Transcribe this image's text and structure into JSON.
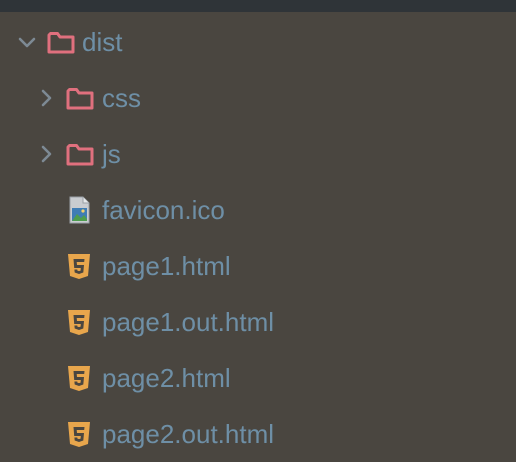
{
  "tree": {
    "root": {
      "label": "dist",
      "expanded": true,
      "icon": "folder-icon"
    },
    "children": [
      {
        "label": "css",
        "type": "folder",
        "expanded": false,
        "icon": "folder-icon"
      },
      {
        "label": "js",
        "type": "folder",
        "expanded": false,
        "icon": "folder-icon"
      },
      {
        "label": "favicon.ico",
        "type": "file",
        "icon": "image-file-icon"
      },
      {
        "label": "page1.html",
        "type": "file",
        "icon": "html5-icon"
      },
      {
        "label": "page1.out.html",
        "type": "file",
        "icon": "html5-icon"
      },
      {
        "label": "page2.html",
        "type": "file",
        "icon": "html5-icon"
      },
      {
        "label": "page2.out.html",
        "type": "file",
        "icon": "html5-icon"
      }
    ]
  },
  "colors": {
    "background": "#4a4640",
    "topbar": "#2f3438",
    "label": "#6e8fa6",
    "folder": "#e0707e",
    "html5": "#e8a64c",
    "chevron": "#7d8a94"
  }
}
